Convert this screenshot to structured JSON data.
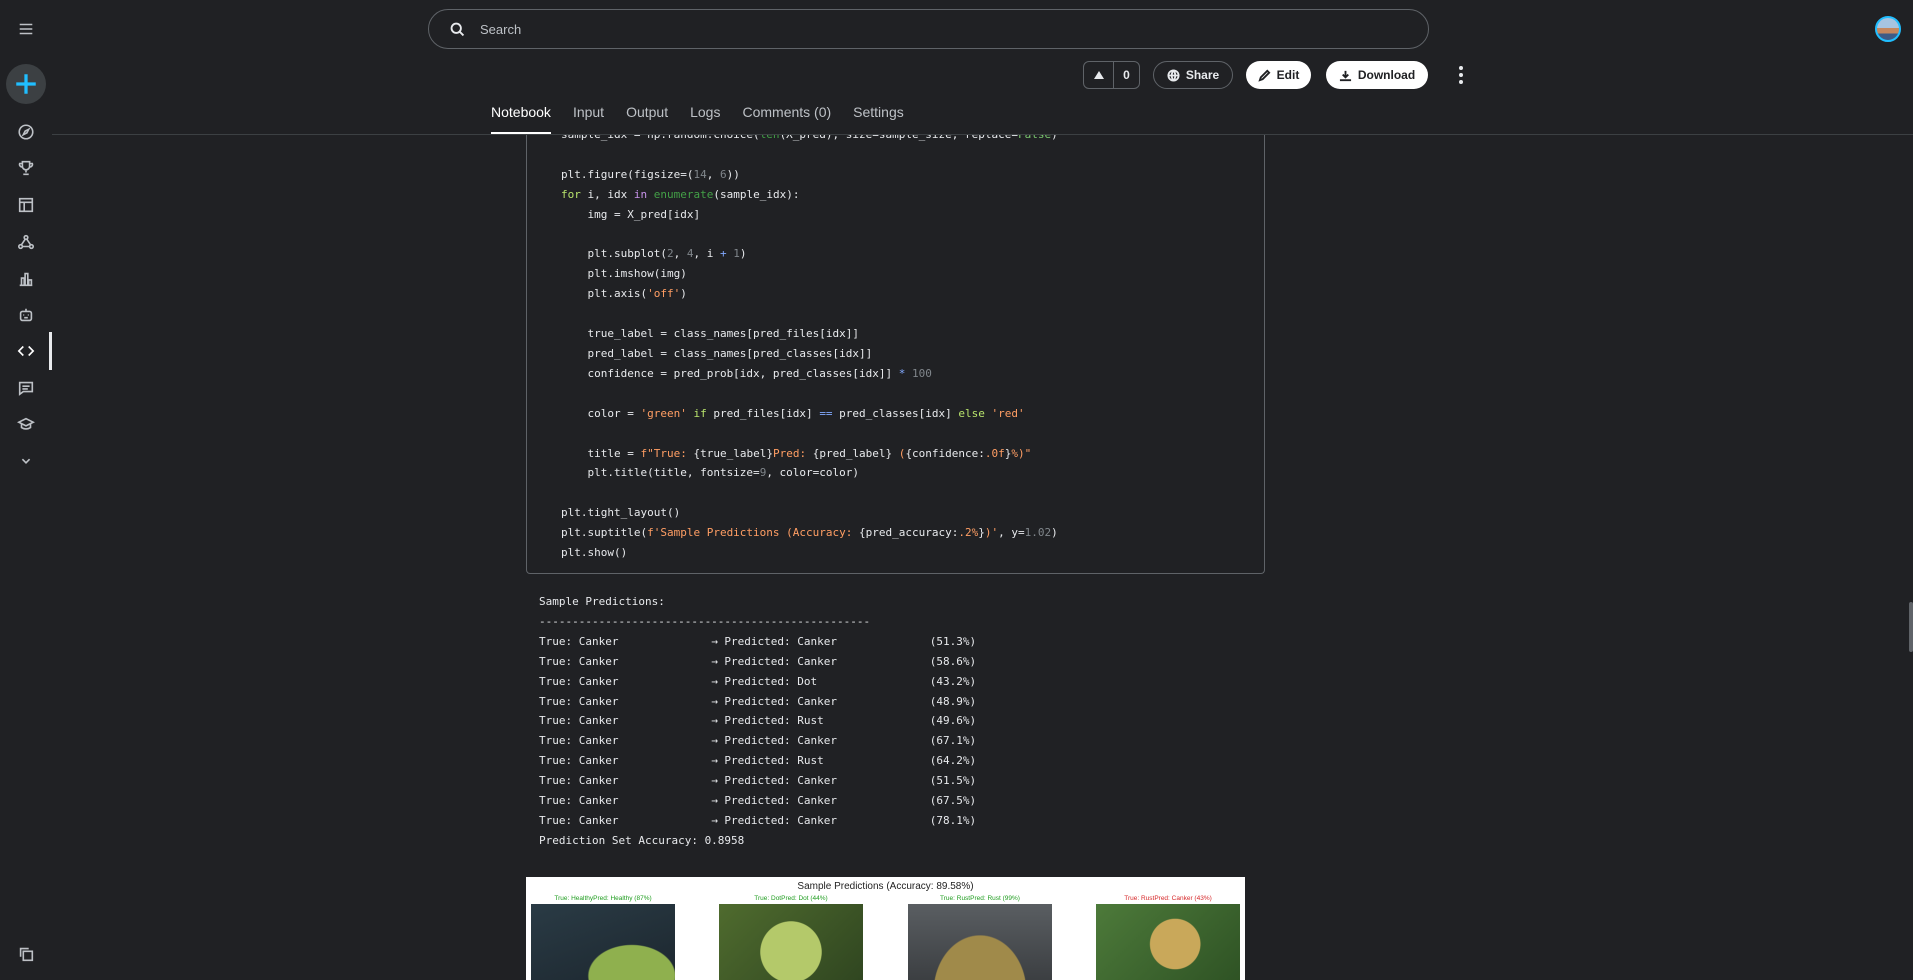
{
  "search": {
    "placeholder": "Search"
  },
  "actions": {
    "vote_count": "0",
    "share": "Share",
    "edit": "Edit",
    "download": "Download"
  },
  "tabs": [
    "Notebook",
    "Input",
    "Output",
    "Logs",
    "Comments (0)",
    "Settings"
  ],
  "sidebar_icons": [
    "menu-icon",
    "create-icon",
    "compass-icon",
    "trophy-icon",
    "table-icon",
    "models-icon",
    "chart-icon",
    "robot-icon",
    "code-icon",
    "comment-icon",
    "school-icon",
    "chevron-down-icon",
    "copy-icon"
  ],
  "output": {
    "header": "Sample Predictions:",
    "divider": "--------------------------------------------------",
    "rows": [
      {
        "true": "True: Canker",
        "pred": "→ Predicted: Canker",
        "conf": "(51.3%)"
      },
      {
        "true": "True: Canker",
        "pred": "→ Predicted: Canker",
        "conf": "(58.6%)"
      },
      {
        "true": "True: Canker",
        "pred": "→ Predicted: Dot",
        "conf": "(43.2%)"
      },
      {
        "true": "True: Canker",
        "pred": "→ Predicted: Canker",
        "conf": "(48.9%)"
      },
      {
        "true": "True: Canker",
        "pred": "→ Predicted: Rust",
        "conf": "(49.6%)"
      },
      {
        "true": "True: Canker",
        "pred": "→ Predicted: Canker",
        "conf": "(67.1%)"
      },
      {
        "true": "True: Canker",
        "pred": "→ Predicted: Rust",
        "conf": "(64.2%)"
      },
      {
        "true": "True: Canker",
        "pred": "→ Predicted: Canker",
        "conf": "(51.5%)"
      },
      {
        "true": "True: Canker",
        "pred": "→ Predicted: Canker",
        "conf": "(67.5%)"
      },
      {
        "true": "True: Canker",
        "pred": "→ Predicted: Canker",
        "conf": "(78.1%)"
      }
    ],
    "accuracy": "Prediction Set Accuracy: 0.8958"
  },
  "figure": {
    "title": "Sample Predictions (Accuracy: 89.58%)",
    "subplots": [
      {
        "label": "True: HealthyPred: Healthy (87%)",
        "color": "#1f9d1f"
      },
      {
        "label": "True: DotPred: Dot (44%)",
        "color": "#1f9d1f"
      },
      {
        "label": "True: RustPred: Rust (99%)",
        "color": "#1f9d1f"
      },
      {
        "label": "True: RustPred: Canker (43%)",
        "color": "#d62728"
      }
    ]
  }
}
